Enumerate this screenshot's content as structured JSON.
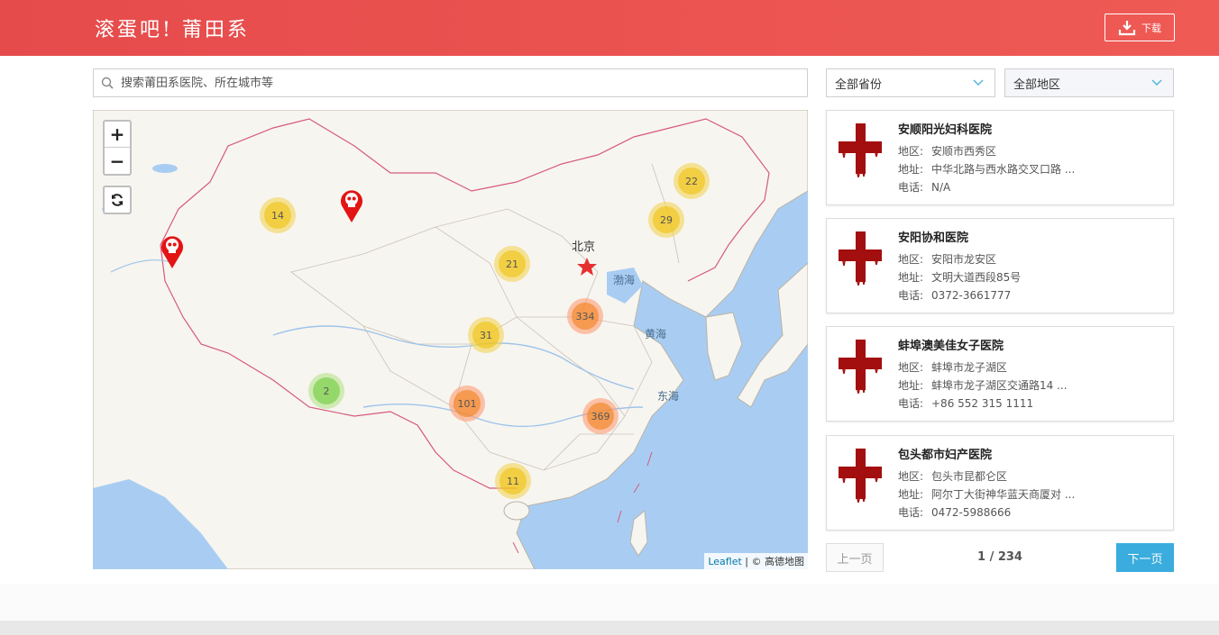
{
  "header": {
    "brand": "滚蛋吧! 莆田系",
    "download_label": "下载",
    "bg_color": "#e84e4e"
  },
  "search": {
    "placeholder": "搜索莆田系医院、所在城市等",
    "value": ""
  },
  "filters": {
    "province": "全部省份",
    "region": "全部地区"
  },
  "map": {
    "zoom_in": "+",
    "zoom_out": "−",
    "clusters": [
      {
        "count": "14",
        "color": "yellow"
      },
      {
        "count": "22",
        "color": "yellow"
      },
      {
        "count": "29",
        "color": "yellow"
      },
      {
        "count": "21",
        "color": "yellow"
      },
      {
        "count": "334",
        "color": "orange"
      },
      {
        "count": "31",
        "color": "yellow"
      },
      {
        "count": "2",
        "color": "green"
      },
      {
        "count": "101",
        "color": "orange"
      },
      {
        "count": "369",
        "color": "orange"
      },
      {
        "count": "11",
        "color": "yellow"
      }
    ],
    "labels": {
      "beijing": "北京",
      "bohai": "渤海",
      "huanghai": "黄海",
      "donghai": "东海"
    },
    "attribution_link": "Leaflet",
    "attribution_text": " | © 高德地图"
  },
  "hospitals": [
    {
      "name": "安顺阳光妇科医院",
      "region_label": "地区:",
      "region": "安顺市西秀区",
      "address_label": "地址:",
      "address": "中华北路与西水路交叉口路 ...",
      "phone_label": "电话:",
      "phone": "N/A"
    },
    {
      "name": "安阳协和医院",
      "region_label": "地区:",
      "region": "安阳市龙安区",
      "address_label": "地址:",
      "address": "文明大道西段85号",
      "phone_label": "电话:",
      "phone": "0372-3661777"
    },
    {
      "name": "蚌埠澳美佳女子医院",
      "region_label": "地区:",
      "region": "蚌埠市龙子湖区",
      "address_label": "地址:",
      "address": "蚌埠市龙子湖区交通路14 ...",
      "phone_label": "电话:",
      "phone": "+86 552 315 1111"
    },
    {
      "name": "包头都市妇产医院",
      "region_label": "地区:",
      "region": "包头市昆都仑区",
      "address_label": "地址:",
      "address": "阿尔丁大街神华蓝天商厦对 ...",
      "phone_label": "电话:",
      "phone": "0472-5988666"
    }
  ],
  "pager": {
    "prev": "上一页",
    "info": "1 / 234",
    "next": "下一页"
  },
  "icons": {
    "download": "download-icon",
    "search": "search-icon",
    "chevron": "chevron-down-icon",
    "refresh": "refresh-icon",
    "marker": "skull-marker-icon",
    "logo": "bloody-cross-icon"
  }
}
